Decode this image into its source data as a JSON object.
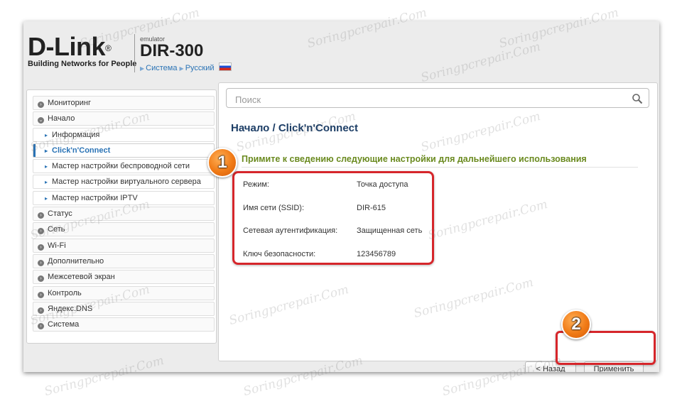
{
  "header": {
    "logo_text": "D-Link",
    "logo_tagline": "Building Networks for People",
    "emulator_label": "emulator",
    "model": "DIR-300",
    "breadcrumb": [
      "Система",
      "Русский"
    ]
  },
  "sidebar": {
    "items": [
      {
        "label": "Мониторинг",
        "level": 0,
        "icon": "chevron-right-icon"
      },
      {
        "label": "Начало",
        "level": 0,
        "icon": "chevron-down-icon"
      },
      {
        "label": "Информация",
        "level": 1
      },
      {
        "label": "Click'n'Connect",
        "level": 1,
        "active": true
      },
      {
        "label": "Мастер настройки беспроводной сети",
        "level": 1
      },
      {
        "label": "Мастер настройки виртуального сервера",
        "level": 1
      },
      {
        "label": "Мастер настройки IPTV",
        "level": 1
      },
      {
        "label": "Статус",
        "level": 0,
        "icon": "chevron-right-icon"
      },
      {
        "label": "Сеть",
        "level": 0,
        "icon": "chevron-right-icon"
      },
      {
        "label": "Wi-Fi",
        "level": 0,
        "icon": "chevron-right-icon"
      },
      {
        "label": "Дополнительно",
        "level": 0,
        "icon": "chevron-right-icon"
      },
      {
        "label": "Межсетевой экран",
        "level": 0,
        "icon": "chevron-right-icon"
      },
      {
        "label": "Контроль",
        "level": 0,
        "icon": "chevron-right-icon"
      },
      {
        "label": "Яндекс.DNS",
        "level": 0,
        "icon": "chevron-right-icon"
      },
      {
        "label": "Система",
        "level": 0,
        "icon": "chevron-right-icon"
      }
    ]
  },
  "search": {
    "placeholder": "Поиск",
    "value": "",
    "icon": "search-icon"
  },
  "main": {
    "title": "Начало /  Click'n'Connect",
    "section_title": "Примите к сведению следующие настройки для дальнейшего использования",
    "settings": [
      {
        "label": "Режим:",
        "value": "Точка доступа"
      },
      {
        "label": "Имя сети (SSID):",
        "value": "DIR-615"
      },
      {
        "label": "Сетевая аутентификация:",
        "value": "Защищенная сеть"
      },
      {
        "label": "Ключ безопасности:",
        "value": "123456789"
      }
    ],
    "back_button": "< Назад",
    "apply_button": "Применить"
  },
  "annotations": {
    "marker_1": "1",
    "marker_2": "2"
  },
  "watermark_text": "Soringpcrepair.Com",
  "colors": {
    "accent_blue": "#2a73b5",
    "title_navy": "#1d3e66",
    "section_green": "#6a8a1f",
    "highlight_red": "#d6262b",
    "marker_orange": "#f07a16"
  }
}
